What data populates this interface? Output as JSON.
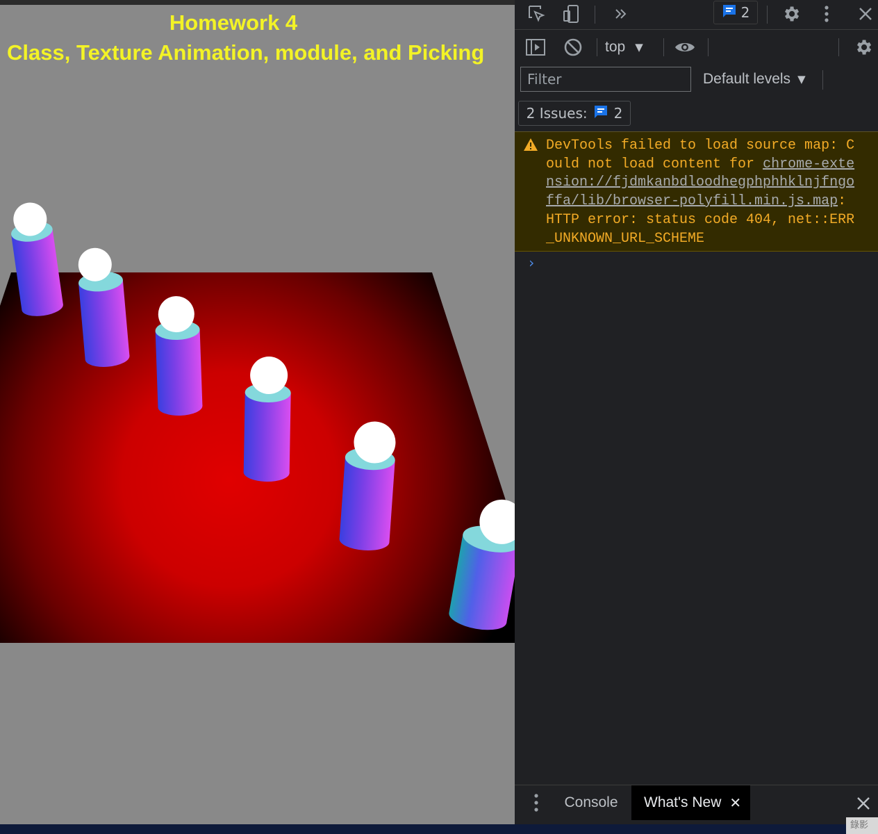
{
  "page": {
    "title_line1": "Homework 4",
    "title_line2": "Class, Texture Animation, module, and Picking"
  },
  "devtools": {
    "toolbar": {
      "issues_count": "2"
    },
    "context": {
      "selected": "top"
    },
    "filter": {
      "placeholder": "Filter",
      "levels_label": "Default levels"
    },
    "issues": {
      "label": "2 Issues:",
      "count": "2"
    },
    "console": {
      "warning_prefix": "DevTools failed to load source map: Could not load content for ",
      "warning_link": "chrome-extension://fjdmkanbdloodhegphphhklnjfngoffa/lib/browser-polyfill.min.js.map",
      "warning_suffix": ": HTTP error: status code 404, net::ERR_UNKNOWN_URL_SCHEME",
      "prompt_symbol": "›"
    },
    "drawer": {
      "tabs": [
        "Console",
        "What's New"
      ],
      "active_tab": "What's New"
    }
  },
  "taskbar": {
    "corner_text": "錄影"
  },
  "colors": {
    "title_yellow": "#f3f326",
    "page_background": "#898989",
    "devtools_background": "#202124",
    "warning_background": "#332b00",
    "warning_text": "#f2ab26",
    "accent_blue": "#1a73e8"
  }
}
